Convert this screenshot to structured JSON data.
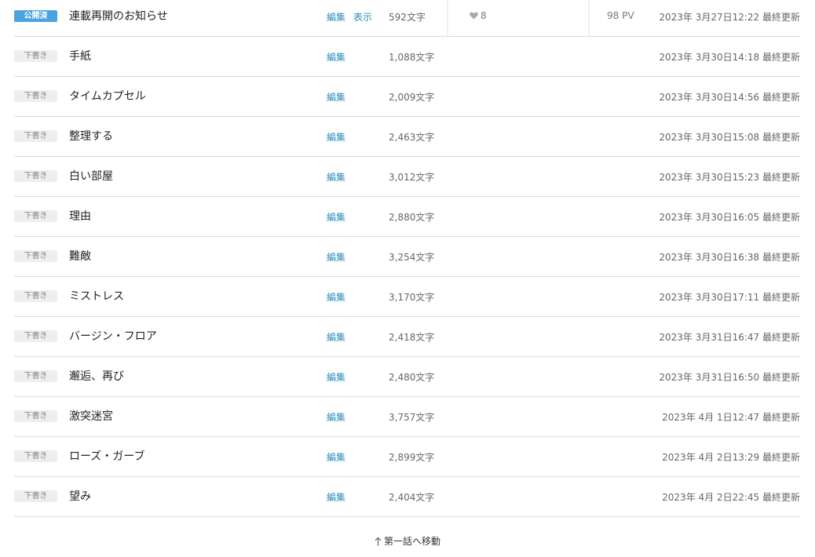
{
  "episodes": [
    {
      "status": "公開済",
      "title": "連載再開のお知らせ",
      "edit": "編集",
      "view": "表示",
      "chars": "592文字",
      "likes": "8",
      "pv": "98 PV",
      "updated": "2023年 3月27日12:22 最終更新"
    },
    {
      "status": "下書き",
      "title": "手紙",
      "edit": "編集",
      "chars": "1,088文字",
      "updated": "2023年 3月30日14:18 最終更新"
    },
    {
      "status": "下書き",
      "title": "タイムカプセル",
      "edit": "編集",
      "chars": "2,009文字",
      "updated": "2023年 3月30日14:56 最終更新"
    },
    {
      "status": "下書き",
      "title": "整理する",
      "edit": "編集",
      "chars": "2,463文字",
      "updated": "2023年 3月30日15:08 最終更新"
    },
    {
      "status": "下書き",
      "title": "白い部屋",
      "edit": "編集",
      "chars": "3,012文字",
      "updated": "2023年 3月30日15:23 最終更新"
    },
    {
      "status": "下書き",
      "title": "理由",
      "edit": "編集",
      "chars": "2,880文字",
      "updated": "2023年 3月30日16:05 最終更新"
    },
    {
      "status": "下書き",
      "title": "難敵",
      "edit": "編集",
      "chars": "3,254文字",
      "updated": "2023年 3月30日16:38 最終更新"
    },
    {
      "status": "下書き",
      "title": "ミストレス",
      "edit": "編集",
      "chars": "3,170文字",
      "updated": "2023年 3月30日17:11 最終更新"
    },
    {
      "status": "下書き",
      "title": "バージン・フロア",
      "edit": "編集",
      "chars": "2,418文字",
      "updated": "2023年 3月31日16:47 最終更新"
    },
    {
      "status": "下書き",
      "title": "邂逅、再び",
      "edit": "編集",
      "chars": "2,480文字",
      "updated": "2023年 3月31日16:50 最終更新"
    },
    {
      "status": "下書き",
      "title": "激突迷宮",
      "edit": "編集",
      "chars": "3,757文字",
      "updated": "2023年 4月 1日12:47 最終更新"
    },
    {
      "status": "下書き",
      "title": "ローズ・ガーブ",
      "edit": "編集",
      "chars": "2,899文字",
      "updated": "2023年 4月 2日13:29 最終更新"
    },
    {
      "status": "下書き",
      "title": "望み",
      "edit": "編集",
      "chars": "2,404文字",
      "updated": "2023年 4月 2日22:45 最終更新"
    }
  ],
  "footer": {
    "back_to_first": "第一話へ移動"
  },
  "icons": {
    "likes": "heart-icon",
    "back_to_first": "arrow-up-icon"
  },
  "colors": {
    "published_badge": "#4aa3df",
    "draft_badge": "#eeeeee",
    "link": "#2a8bc0"
  }
}
